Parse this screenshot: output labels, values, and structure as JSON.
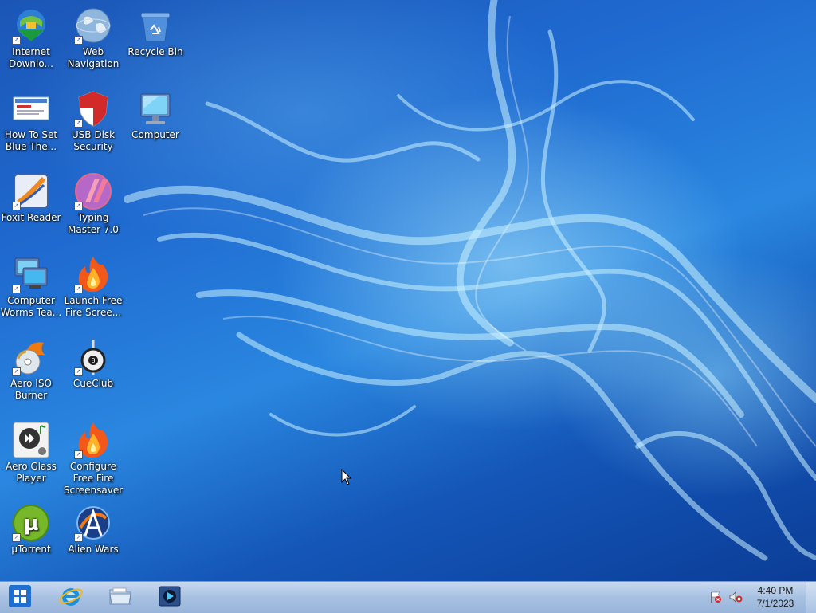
{
  "desktop": {
    "icons": [
      {
        "label": "Internet\nDownlo...",
        "icon": "internet-download-manager-icon"
      },
      {
        "label": "Web\nNavigation",
        "icon": "globe-icon"
      },
      {
        "label": "Recycle Bin",
        "icon": "recycle-bin-icon"
      },
      {
        "label": "How To Set\nBlue The...",
        "icon": "document-thumbnail-icon"
      },
      {
        "label": "USB Disk\nSecurity",
        "icon": "shield-icon"
      },
      {
        "label": "Computer",
        "icon": "computer-icon"
      },
      {
        "label": "Foxit Reader",
        "icon": "foxit-reader-icon"
      },
      {
        "label": "Typing\nMaster 7.0",
        "icon": "typing-master-icon"
      },
      {
        "label": "Computer\nWorms Tea...",
        "icon": "computers-icon"
      },
      {
        "label": "Launch Free\nFire Scree...",
        "icon": "fire-icon"
      },
      {
        "label": "Aero ISO\nBurner",
        "icon": "disc-flame-icon"
      },
      {
        "label": "CueClub",
        "icon": "cue-ball-icon"
      },
      {
        "label": "Aero Glass\nPlayer",
        "icon": "media-player-gadget-icon"
      },
      {
        "label": "Configure\nFree Fire\nScreensaver",
        "icon": "fire-icon"
      },
      {
        "label": "µTorrent",
        "icon": "utorrent-icon"
      },
      {
        "label": "Alien Wars",
        "icon": "alien-wars-icon"
      }
    ]
  },
  "taskbar": {
    "start_icon": "windows-logo-icon",
    "pinned": [
      {
        "name": "Internet Explorer",
        "icon": "internet-explorer-icon"
      },
      {
        "name": "Windows Explorer",
        "icon": "folder-icon"
      },
      {
        "name": "Media Player",
        "icon": "media-player-icon"
      }
    ],
    "tray": {
      "icons": [
        "flag-alert-icon",
        "speaker-muted-icon"
      ],
      "time": "4:40 PM",
      "date": "7/1/2023"
    }
  },
  "colors": {
    "desktop_blue": "#1f6ad0",
    "taskbar": "#a8c1e2"
  }
}
